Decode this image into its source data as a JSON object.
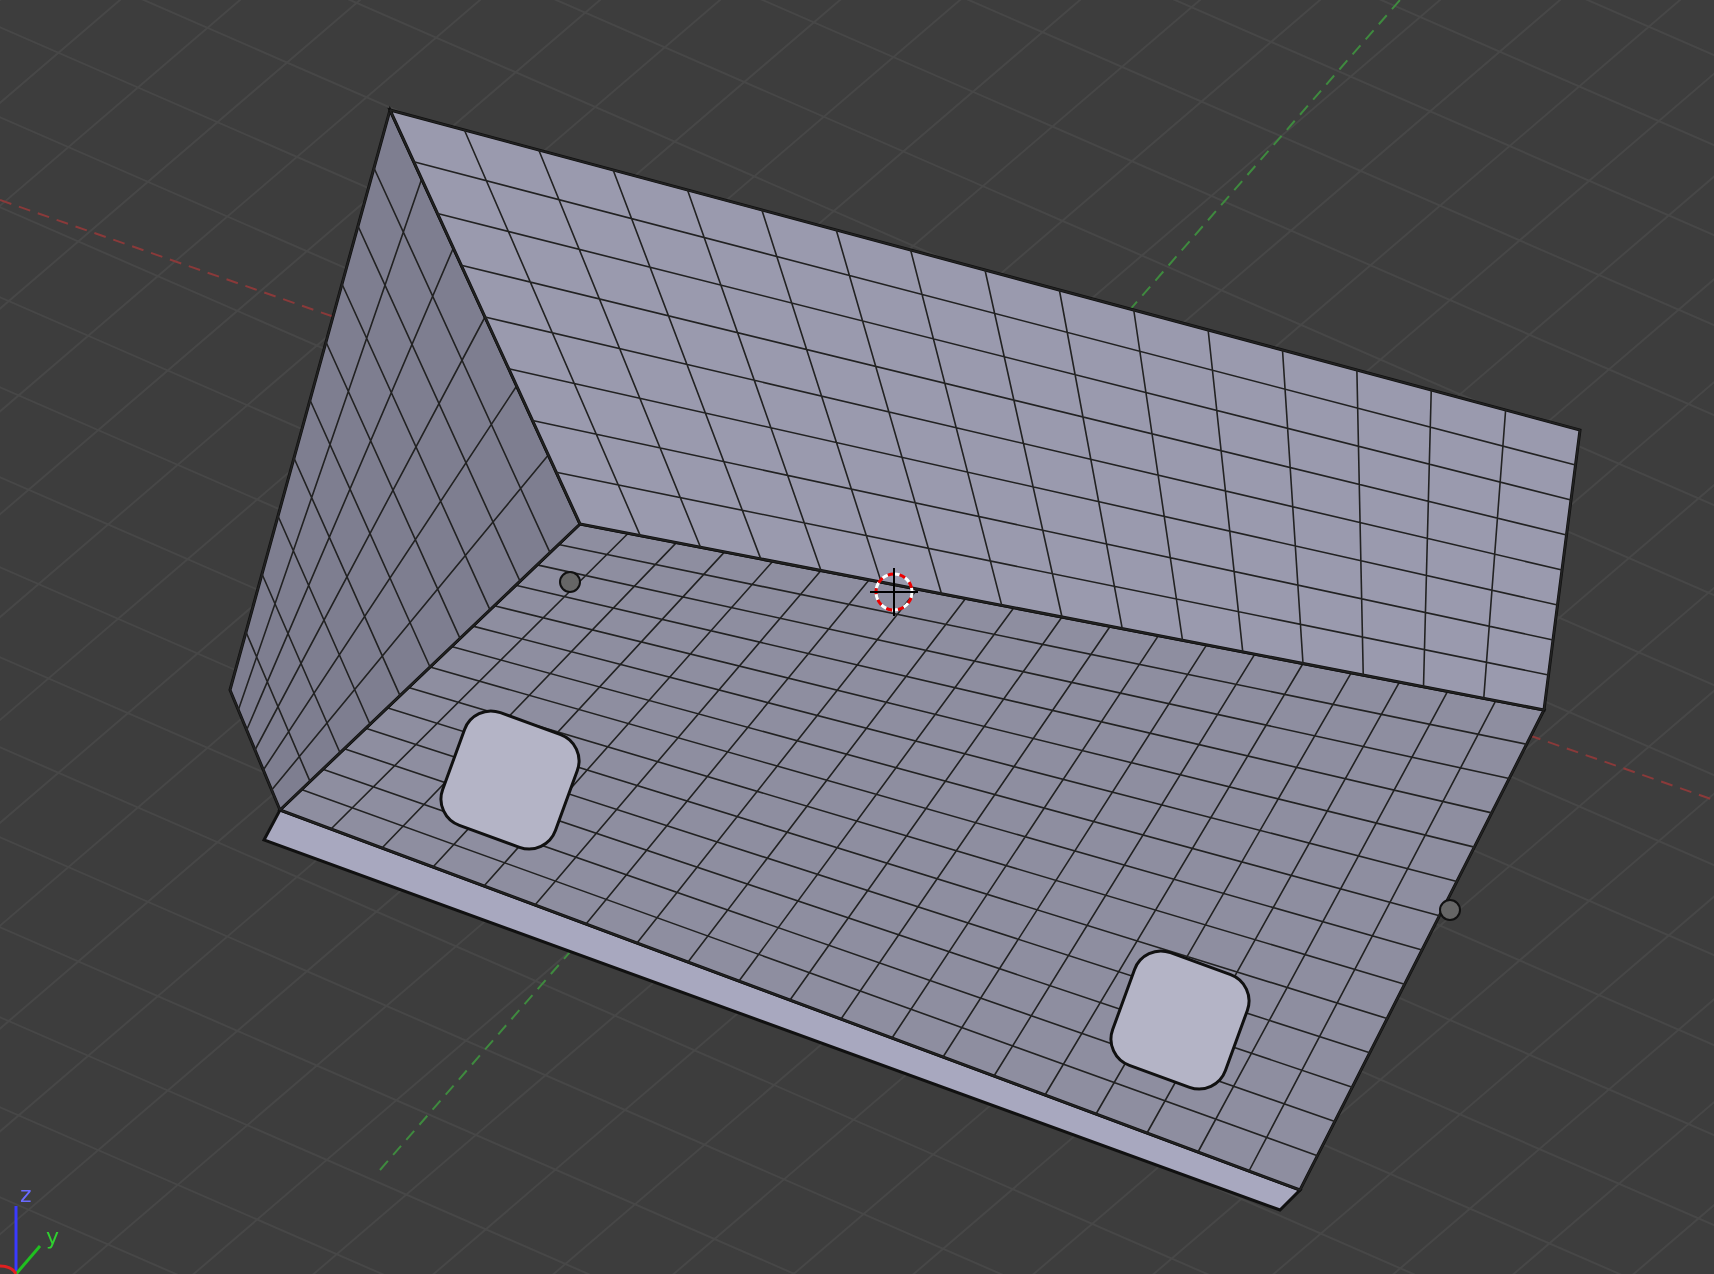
{
  "viewport": {
    "gizmo": {
      "z_label": "z",
      "y_label": "y"
    }
  }
}
